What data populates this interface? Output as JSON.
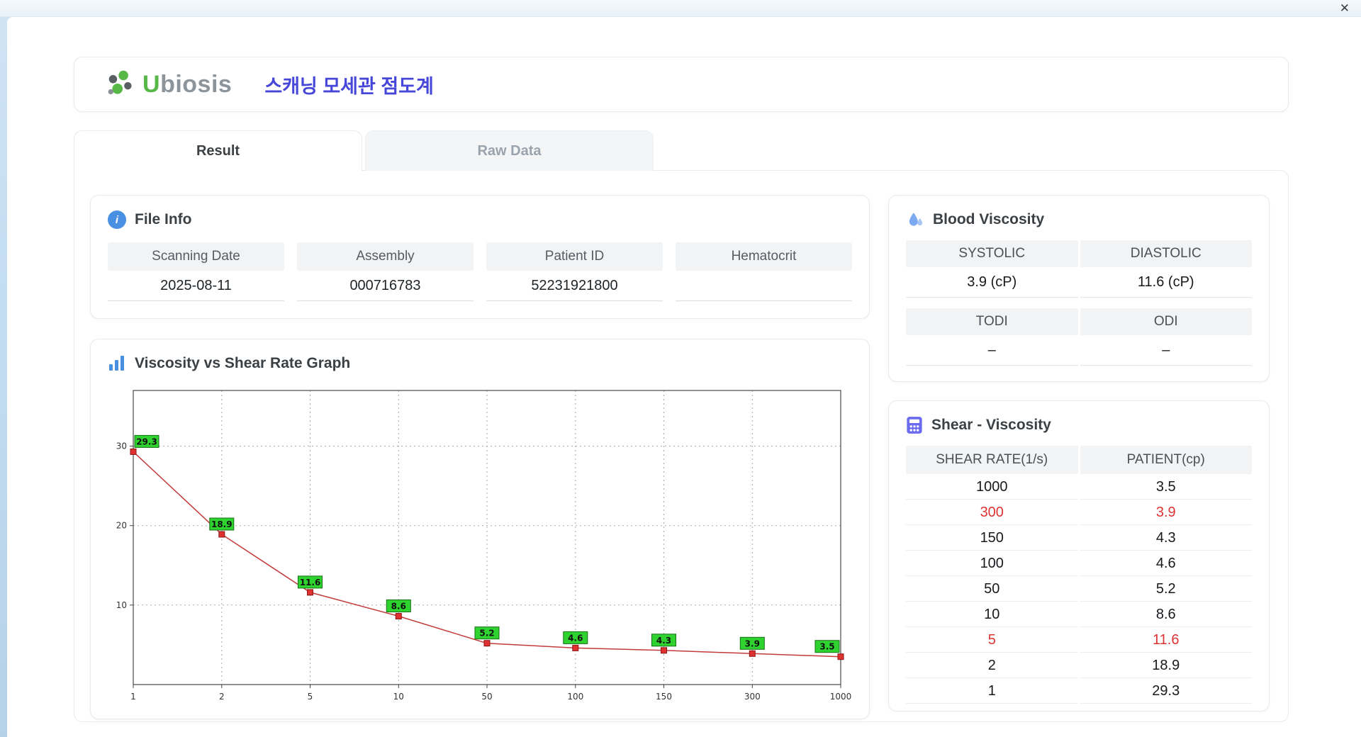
{
  "window": {
    "close": "✕"
  },
  "header": {
    "brand_first": "U",
    "brand_rest": "biosis",
    "title": "스캐닝 모세관 점도계"
  },
  "tabs": {
    "result": "Result",
    "raw_data": "Raw Data"
  },
  "file_info": {
    "title": "File Info",
    "icon": "info-icon",
    "icon_glyph": "i",
    "fields": [
      {
        "label": "Scanning Date",
        "value": "2025-08-11"
      },
      {
        "label": "Assembly",
        "value": "000716783"
      },
      {
        "label": "Patient ID",
        "value": "52231921800"
      },
      {
        "label": "Hematocrit",
        "value": ""
      }
    ]
  },
  "graph": {
    "title": "Viscosity vs Shear Rate Graph",
    "icon": "bar-chart-icon"
  },
  "blood_viscosity": {
    "title": "Blood Viscosity",
    "icon": "droplet-icon",
    "top": [
      {
        "header": "SYSTOLIC",
        "value": "3.9 (cP)"
      },
      {
        "header": "DIASTOLIC",
        "value": "11.6 (cP)"
      }
    ],
    "bottom": [
      {
        "header": "TODI",
        "value": "–"
      },
      {
        "header": "ODI",
        "value": "–"
      }
    ]
  },
  "shear_viscosity": {
    "title": "Shear - Viscosity",
    "icon": "calculator-icon",
    "headers": [
      "SHEAR RATE(1/s)",
      "PATIENT(cp)"
    ],
    "rows": [
      {
        "shear": "1000",
        "patient": "3.5",
        "highlight": false
      },
      {
        "shear": "300",
        "patient": "3.9",
        "highlight": true
      },
      {
        "shear": "150",
        "patient": "4.3",
        "highlight": false
      },
      {
        "shear": "100",
        "patient": "4.6",
        "highlight": false
      },
      {
        "shear": "50",
        "patient": "5.2",
        "highlight": false
      },
      {
        "shear": "10",
        "patient": "8.6",
        "highlight": false
      },
      {
        "shear": "5",
        "patient": "11.6",
        "highlight": true
      },
      {
        "shear": "2",
        "patient": "18.9",
        "highlight": false
      },
      {
        "shear": "1",
        "patient": "29.3",
        "highlight": false
      }
    ]
  },
  "chart_data": {
    "type": "line",
    "title": "Viscosity vs Shear Rate Graph",
    "xlabel": "",
    "ylabel": "",
    "x_scale": "categorical",
    "categories": [
      "1",
      "2",
      "5",
      "10",
      "50",
      "100",
      "150",
      "300",
      "1000"
    ],
    "values": [
      29.3,
      18.9,
      11.6,
      8.6,
      5.2,
      4.6,
      4.3,
      3.9,
      3.5
    ],
    "yticks": [
      10,
      20,
      30
    ],
    "ylim": [
      0,
      37
    ],
    "grid": true,
    "legend": false,
    "line_color": "#c23b3b",
    "marker_color": "#e03131",
    "label_bg": "#2fd32f"
  }
}
